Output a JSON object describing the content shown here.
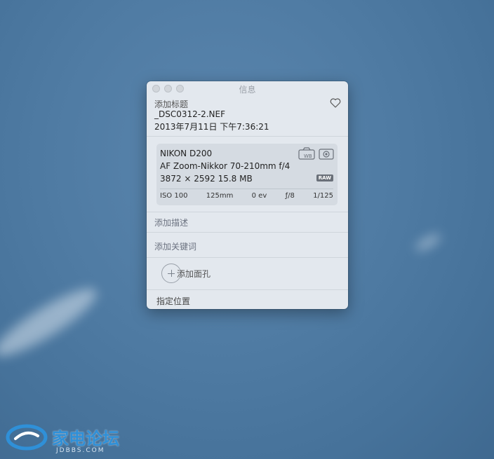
{
  "window": {
    "title": "信息"
  },
  "header": {
    "add_title": "添加标题",
    "filename": "_DSC0312-2.NEF",
    "datetime": "2013年7月11日   下午7:36:21"
  },
  "exif": {
    "camera": "NIKON D200",
    "lens": "AF Zoom-Nikkor 70-210mm f/4",
    "dims_size": "3872 × 2592   15.8 MB",
    "raw_badge": "RAW",
    "iso": "ISO 100",
    "focal": "125mm",
    "ev": "0 ev",
    "aperture": "ƒ/8",
    "shutter": "1/125"
  },
  "fields": {
    "description": "添加描述",
    "keywords": "添加关键词",
    "faces": "添加面孔",
    "location": "指定位置"
  },
  "watermark": {
    "brand": "家电论坛",
    "site": "JDBBS.COM"
  }
}
